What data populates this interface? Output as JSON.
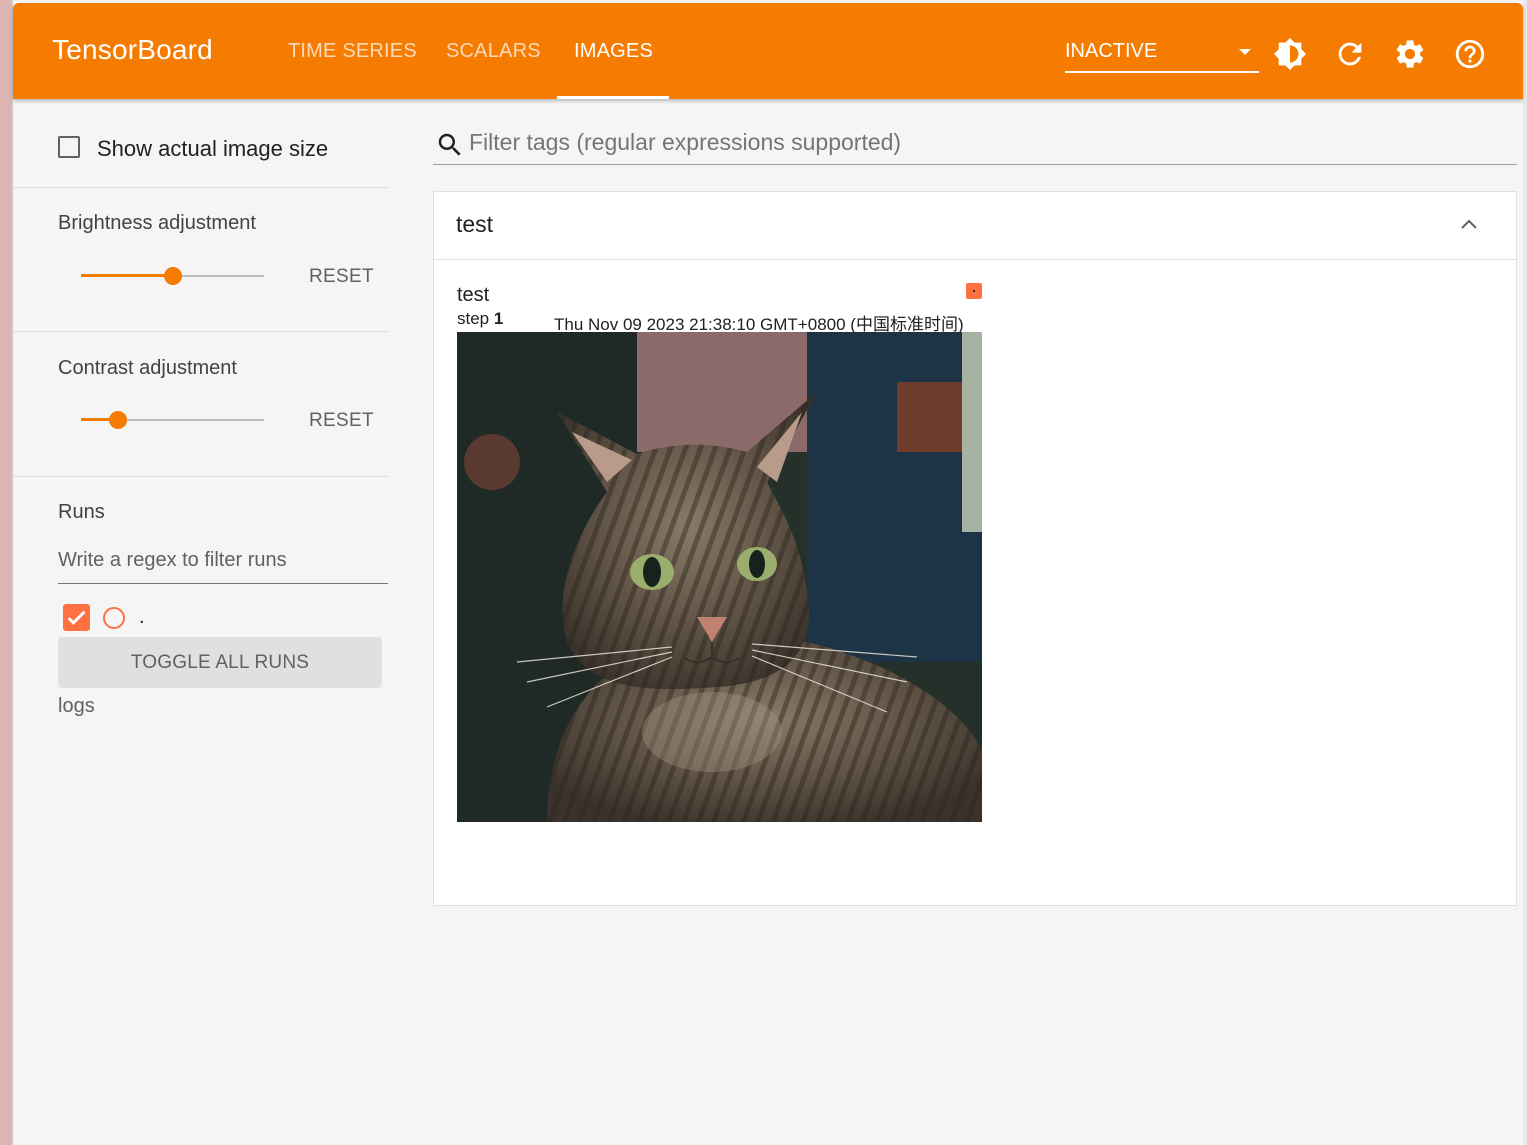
{
  "app": {
    "title": "TensorBoard",
    "tabs": [
      {
        "label": "TIME SERIES",
        "active": false
      },
      {
        "label": "SCALARS",
        "active": false
      },
      {
        "label": "IMAGES",
        "active": true
      }
    ],
    "run_selector": {
      "value": "INACTIVE"
    },
    "icons": [
      "theme-toggle-icon",
      "refresh-icon",
      "settings-icon",
      "help-icon"
    ],
    "accent_color": "#f57c00"
  },
  "sidebar": {
    "show_actual_size": {
      "label": "Show actual image size",
      "checked": false
    },
    "brightness": {
      "title": "Brightness adjustment",
      "reset_label": "RESET",
      "value": 0.5
    },
    "contrast": {
      "title": "Contrast adjustment",
      "reset_label": "RESET",
      "value": 0.2
    },
    "runs": {
      "title": "Runs",
      "filter_placeholder": "Write a regex to filter runs",
      "items": [
        {
          "name": ".",
          "checked": true,
          "color": "#ff7043"
        }
      ],
      "toggle_label": "TOGGLE ALL RUNS",
      "logdir": "logs"
    }
  },
  "main": {
    "filter_placeholder": "Filter tags (regular expressions supported)",
    "card": {
      "title": "test",
      "image": {
        "tag": "test",
        "step_label": "step",
        "step": "1",
        "timestamp": "Thu Nov 09 2023 21:38:10 GMT+0800 (中国标准时间)"
      }
    }
  }
}
